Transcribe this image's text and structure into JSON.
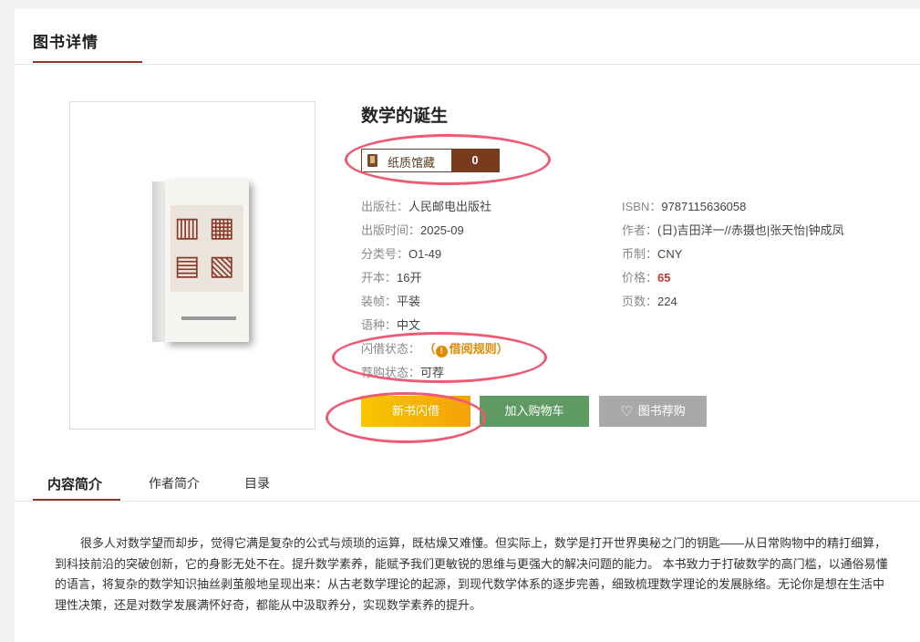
{
  "section": {
    "title": "图书详情"
  },
  "book": {
    "title": "数学的诞生",
    "holding": {
      "label": "纸质馆藏",
      "count": "0"
    },
    "details_left": [
      {
        "label": "出版社：",
        "value": "人民邮电出版社"
      },
      {
        "label": "出版时间：",
        "value": "2025-09"
      },
      {
        "label": "分类号：",
        "value": "O1-49"
      },
      {
        "label": "开本：",
        "value": "16开"
      },
      {
        "label": "装帧：",
        "value": "平装"
      },
      {
        "label": "语种：",
        "value": "中文"
      }
    ],
    "details_right": [
      {
        "label": "ISBN：",
        "value": "9787115636058"
      },
      {
        "label": "作者：",
        "value": "(日)吉田洋一//赤摄也|张天怡|钟成凤"
      },
      {
        "label": "币制：",
        "value": "CNY"
      },
      {
        "label": "价格：",
        "value": "65"
      },
      {
        "label": "页数：",
        "value": "224"
      }
    ],
    "flash_borrow": {
      "label": "闪借状态：",
      "link": "（",
      "link_text": "借阅规则）"
    },
    "recommend_status": {
      "label": "荐购状态：",
      "value": "可荐"
    }
  },
  "buttons": {
    "borrow": "新书闪借",
    "cart": "加入购物车",
    "recommend": "图书荐购"
  },
  "tabs": [
    "内容简介",
    "作者简介",
    "目录"
  ],
  "description": "很多人对数学望而却步，觉得它满是复杂的公式与烦琐的运算，既枯燥又难懂。但实际上，数学是打开世界奥秘之门的钥匙——从日常购物中的精打细算，到科技前沿的突破创新，它的身影无处不在。提升数学素养，能赋予我们更敏锐的思维与更强大的解决问题的能力。 本书致力于打破数学的高门槛，以通俗易懂的语言，将复杂的数学知识抽丝剥茧般地呈现出来：从古老数学理论的起源，到现代数学体系的逐步完善，细致梳理数学理论的发展脉络。无论你是想在生活中理性决策，还是对数学发展满怀好奇，都能从中汲取养分，实现数学素养的提升。",
  "colors": {
    "accent": "#8b3a2a",
    "price": "#c0392b",
    "warning": "#e08a00",
    "annotation": "#ec5b73"
  }
}
